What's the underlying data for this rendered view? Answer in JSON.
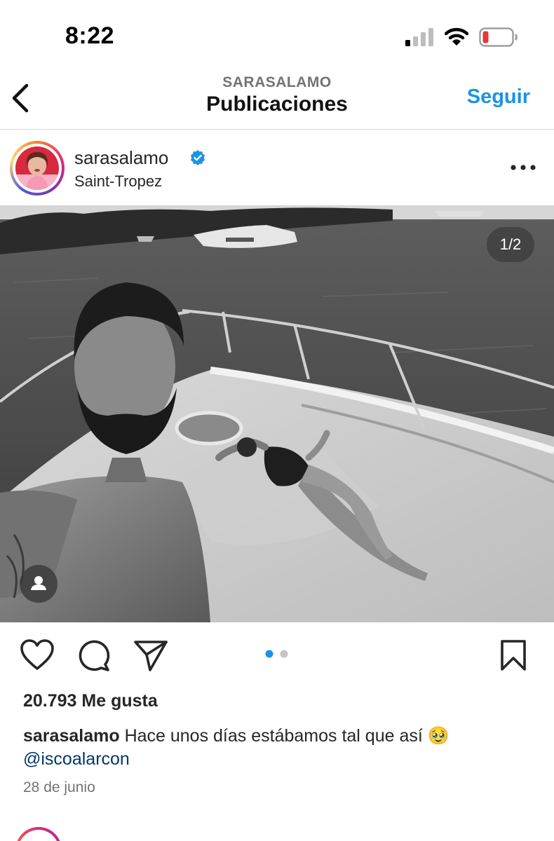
{
  "status_bar": {
    "time": "8:22",
    "battery_color": "#e53935"
  },
  "header": {
    "account": "SARASALAMO",
    "title": "Publicaciones",
    "follow_label": "Seguir",
    "accent_color": "#1a93e6"
  },
  "post": {
    "username": "sarasalamo",
    "verified": true,
    "location": "Saint-Tropez",
    "image_counter": "1/2",
    "carousel": {
      "total": 2,
      "active": 1
    },
    "likes": "20.793 Me gusta",
    "caption": {
      "username": "sarasalamo",
      "text": "Hace unos días estábamos tal que así",
      "emoji": "🥹",
      "mention": "@iscoalarcon"
    },
    "date": "28 de junio"
  },
  "icons": {
    "back": "chevron-left-icon",
    "more": "more-horizontal-icon",
    "like": "heart-icon",
    "comment": "comment-icon",
    "share": "paper-plane-icon",
    "save": "bookmark-icon",
    "tag": "person-icon"
  }
}
